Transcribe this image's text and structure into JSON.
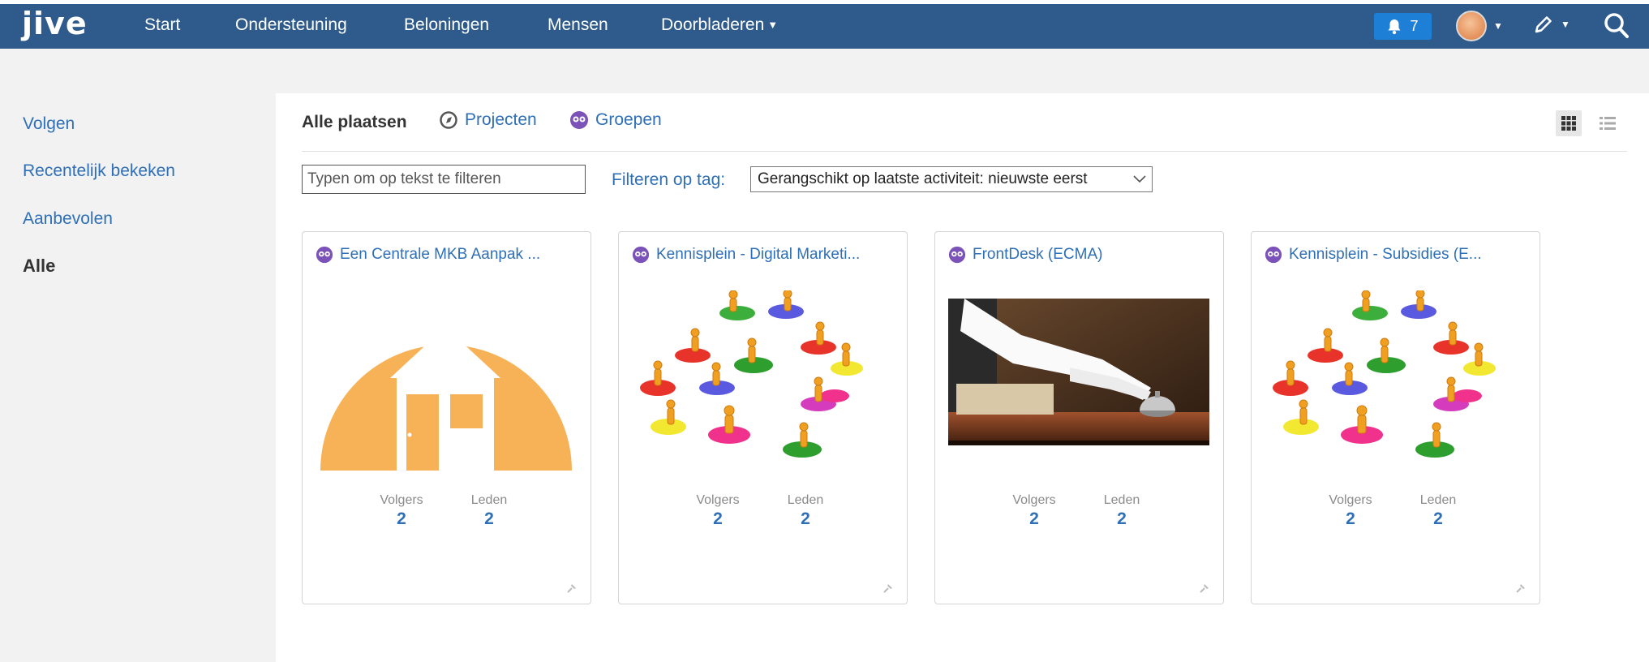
{
  "app": {
    "logo": "jive"
  },
  "nav": {
    "items": [
      "Start",
      "Ondersteuning",
      "Beloningen",
      "Mensen",
      "Doorbladeren"
    ],
    "notification_count": "7"
  },
  "sidebar": {
    "items": [
      "Volgen",
      "Recentelijk bekeken",
      "Aanbevolen",
      "Alle"
    ],
    "active": "Alle"
  },
  "tabs": {
    "all": "Alle plaatsen",
    "projects": "Projecten",
    "groups": "Groepen"
  },
  "filter": {
    "placeholder": "Typen om op tekst te filteren",
    "tag_label": "Filteren op tag:",
    "sort_value": "Gerangschikt op laatste activiteit: nieuwste eerst"
  },
  "cards": [
    {
      "title": "Een Centrale MKB Aanpak ...",
      "image": "house-icon",
      "followers_label": "Volgers",
      "followers": "2",
      "members_label": "Leden",
      "members": "2"
    },
    {
      "title": "Kennisplein - Digital Marketi...",
      "image": "puzzle-people-image",
      "followers_label": "Volgers",
      "followers": "2",
      "members_label": "Leden",
      "members": "2"
    },
    {
      "title": "FrontDesk (ECMA)",
      "image": "reception-bell-image",
      "followers_label": "Volgers",
      "followers": "2",
      "members_label": "Leden",
      "members": "2"
    },
    {
      "title": "Kennisplein - Subsidies (E...",
      "image": "puzzle-people-image",
      "followers_label": "Volgers",
      "followers": "2",
      "members_label": "Leden",
      "members": "2"
    }
  ],
  "colors": {
    "nav_bg": "#2e5b8c",
    "link": "#2e6fb6",
    "group_icon": "#7b52b8",
    "house_bg": "#f7b257"
  }
}
